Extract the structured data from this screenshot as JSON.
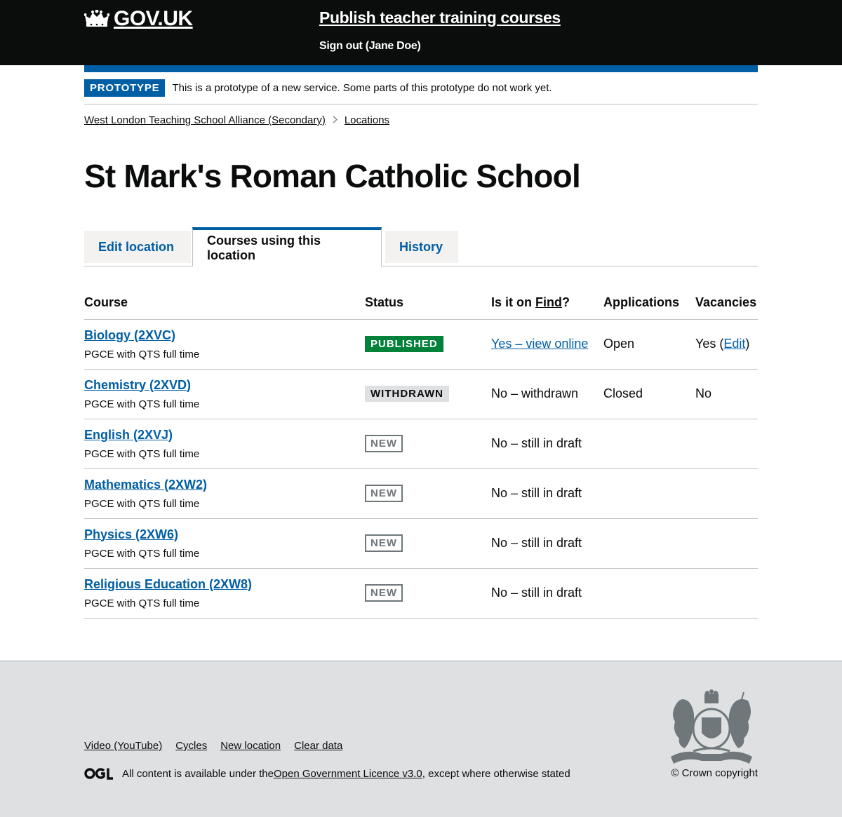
{
  "header": {
    "logo_text": "GOV.UK",
    "service_name": "Publish teacher training courses",
    "signout_label": "Sign out (Jane Doe)"
  },
  "phase_banner": {
    "tag": "PROTOTYPE",
    "text": "This is a prototype of a new service. Some parts of this prototype do not work yet."
  },
  "breadcrumb": {
    "items": [
      "West London Teaching School Alliance (Secondary)",
      "Locations"
    ]
  },
  "page_title": "St Mark's Roman Catholic School",
  "tabs": [
    {
      "label": "Edit location",
      "selected": false
    },
    {
      "label": "Courses using this location",
      "selected": true
    },
    {
      "label": "History",
      "selected": false
    }
  ],
  "table": {
    "headers": {
      "course": "Course",
      "status": "Status",
      "find_prefix": "Is it on ",
      "find_link": "Find",
      "find_suffix": "?",
      "applications": "Applications",
      "vacancies": "Vacancies"
    },
    "rows": [
      {
        "course": "Biology (2XVC)",
        "subtitle": "PGCE with QTS full time",
        "status": "PUBLISHED",
        "find": "Yes – view online",
        "applications": "Open",
        "vacancies_prefix": "Yes (",
        "vacancies_link": "Edit",
        "vacancies_suffix": ")"
      },
      {
        "course": "Chemistry (2XVD)",
        "subtitle": "PGCE with QTS full time",
        "status": "WITHDRAWN",
        "find": "No – withdrawn",
        "applications": "Closed",
        "vacancies": "No"
      },
      {
        "course": "English (2XVJ)",
        "subtitle": "PGCE with QTS full time",
        "status": "NEW",
        "find": "No – still in draft"
      },
      {
        "course": "Mathematics (2XW2)",
        "subtitle": "PGCE with QTS full time",
        "status": "NEW",
        "find": "No – still in draft"
      },
      {
        "course": "Physics (2XW6)",
        "subtitle": "PGCE with QTS full time",
        "status": "NEW",
        "find": "No – still in draft"
      },
      {
        "course": "Religious Education (2XW8)",
        "subtitle": "PGCE with QTS full time",
        "status": "NEW",
        "find": "No – still in draft"
      }
    ]
  },
  "footer": {
    "links": [
      "Video (YouTube)",
      "Cycles",
      "New location",
      "Clear data"
    ],
    "licence_prefix": "All content is available under the ",
    "licence_link": "Open Government Licence v3.0",
    "licence_suffix": ", except where otherwise stated",
    "copyright": "© Crown copyright"
  },
  "colors": {
    "header_bg": "#0b0c0c",
    "link_blue": "#005ea5",
    "published_green": "#00823b",
    "withdrawn_grey": "#dee0e2",
    "footer_bg": "#dee0e2"
  }
}
